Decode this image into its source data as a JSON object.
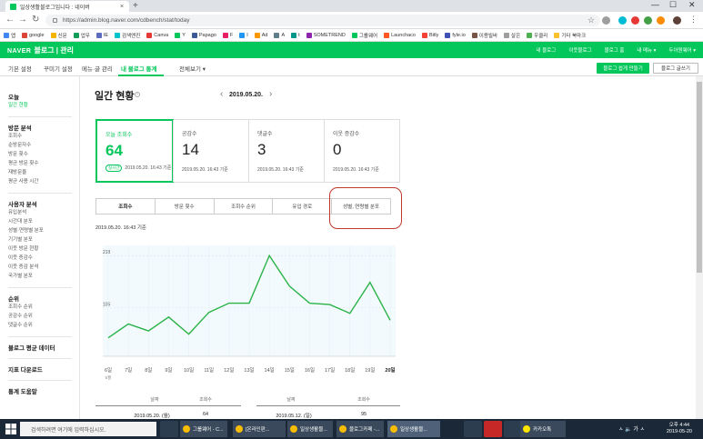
{
  "browser": {
    "tab_title": "일상생활블로그입니다 : 네이버",
    "tab_close": "×",
    "new_tab": "+",
    "url": "https://admin.blog.naver.com/cdbench/stat/today",
    "bookmarks": [
      "앱",
      "google",
      "신문",
      "업무",
      "IE",
      "검색엔진",
      "Canva",
      "Y",
      "Papago",
      "F",
      "I",
      "Ad",
      "A",
      "t",
      "SOMETREND",
      "그룹웨어",
      "Launchaco",
      "Bitly",
      "fyle.io",
      "이용빌바",
      "살은",
      "우클리",
      "기타 북마크"
    ]
  },
  "header": {
    "logo_naver": "NAVER",
    "logo_title": "블로그 | 관리",
    "links": [
      "내 블로그",
      "이웃블로그",
      "블로그 홈",
      "내 메뉴 ▾",
      "두아원웨어 ▾"
    ]
  },
  "subnav": {
    "items": [
      "기본 설정",
      "꾸미기 설정",
      "메뉴·글 관리",
      "내 블로그 통계",
      "전체보기 ▾"
    ],
    "make_button": "블로그 쉽게 만들기",
    "write_button": "블로그 글쓰기"
  },
  "sidebar": {
    "groups": [
      {
        "title": "오늘",
        "items": [
          "일간 현황"
        ]
      },
      {
        "title": "방문 분석",
        "items": [
          "조회수",
          "순방문자수",
          "방문 횟수",
          "평균 방문 횟수",
          "재방문율",
          "평균 사용 시간"
        ]
      },
      {
        "title": "사용자 분석",
        "items": [
          "유입분석",
          "시간대 분포",
          "성별·연령별 분포",
          "기기별 분포",
          "이웃 방문 현황",
          "이웃 증감수",
          "이웃 증감 분석",
          "국가별 분포"
        ]
      },
      {
        "title": "순위",
        "items": [
          "조회수 순위",
          "공감수 순위",
          "댓글수 순위"
        ]
      },
      {
        "title": "블로그 평균 데이터",
        "items": []
      },
      {
        "title": "지표 다운로드",
        "items": []
      },
      {
        "title": "통계 도움말",
        "items": []
      }
    ]
  },
  "page": {
    "title": "일간 현황",
    "help": "?",
    "date": "2019.05.20.",
    "prev": "‹",
    "next": "›"
  },
  "cards": [
    {
      "label": "오늘 조회수",
      "value": "64",
      "badge": "실시간",
      "date": "2019.05.20. 16:43 기준"
    },
    {
      "label": "공감수",
      "value": "14",
      "date": "2019.05.20. 16:43 기준"
    },
    {
      "label": "댓글수",
      "value": "3",
      "date": "2019.05.20. 16:43 기준"
    },
    {
      "label": "이웃 증감수",
      "value": "0",
      "date": "2019.05.20. 16:43 기준"
    }
  ],
  "chart_tabs": [
    "조회수",
    "방문 횟수",
    "조회수 순위",
    "유입 경로",
    "성별, 연령별 분포"
  ],
  "chart_time": "2019.05.20. 16:43 기준",
  "chart_data": {
    "type": "line",
    "categories": [
      "6일",
      "7일",
      "8일",
      "9일",
      "10일",
      "11일",
      "12일",
      "13일",
      "14일",
      "15일",
      "16일",
      "17일",
      "18일",
      "19일",
      "20일"
    ],
    "values": [
      40,
      70,
      55,
      85,
      48,
      95,
      115,
      115,
      218,
      152,
      115,
      112,
      93,
      160,
      78
    ],
    "ylim": [
      0,
      240
    ],
    "yticks": [
      105,
      218
    ],
    "x_sub": "5월",
    "color": "#2bb34a"
  },
  "table": {
    "headers": [
      "날짜",
      "조회수",
      "날짜",
      "조회수"
    ],
    "rows": [
      [
        "2019.05.20. (월)",
        "64",
        "2019.05.12. (일)",
        "95"
      ]
    ]
  },
  "taskbar": {
    "search": "검색하려면 여기에 입력하십시오.",
    "apps": [
      "그룹웨어 - C...",
      "[온라인판...",
      "일상생활블...",
      "블로그카페 -...",
      "일상생활블..."
    ],
    "kakao": "카카오톡",
    "tray": "ㅅ 🔈 가 ㅅ",
    "time": "오후 4:44",
    "date": "2019-05-20"
  }
}
